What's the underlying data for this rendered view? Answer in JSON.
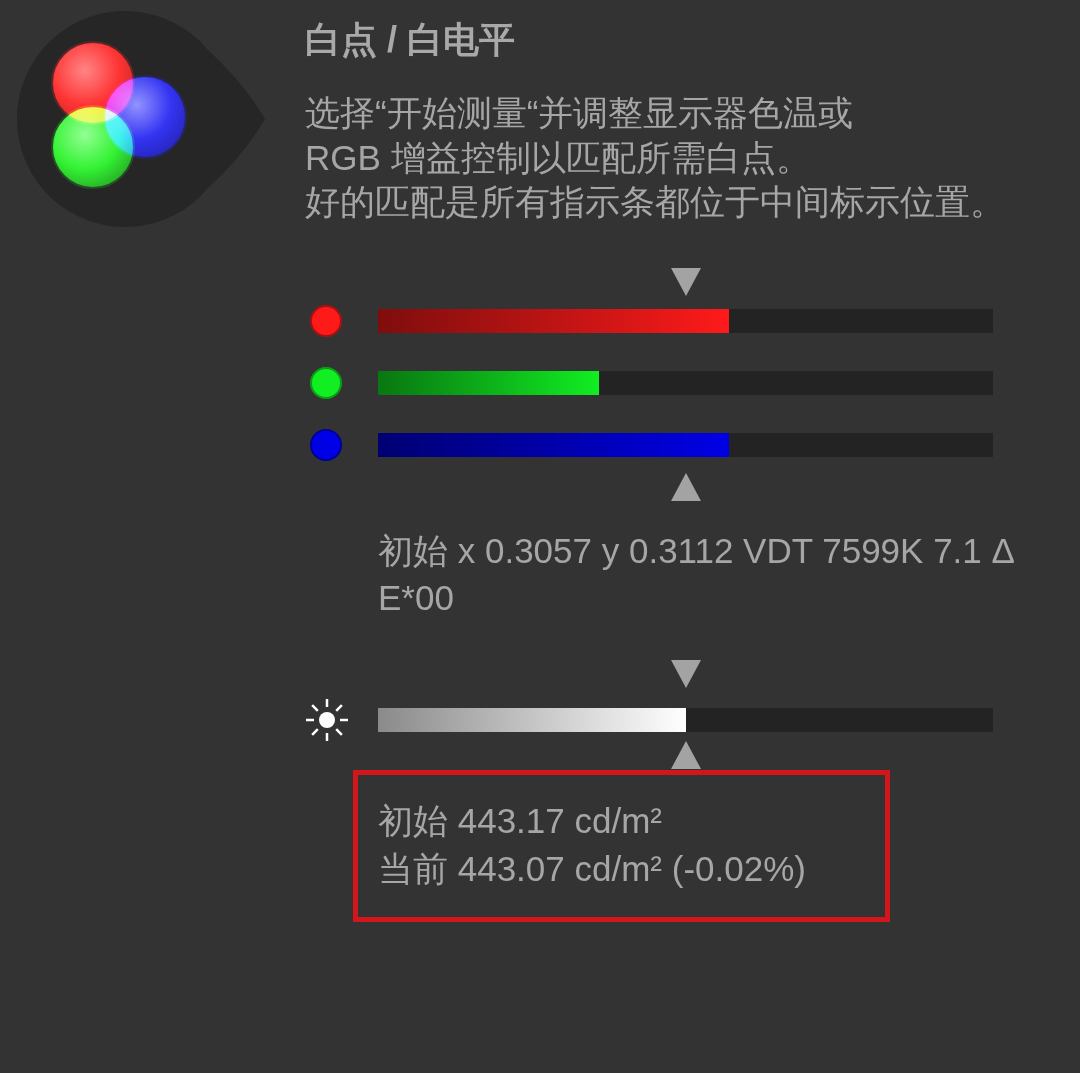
{
  "title": "白点 / 白电平",
  "instructions": [
    "选择“开始测量“并调整显示器色温或",
    "RGB 增益控制以匹配所需白点。",
    "好的匹配是所有指示条都位于中间标示位置。"
  ],
  "channels": [
    {
      "color": "#ff1a1a",
      "level": 0.57
    },
    {
      "color": "#11ee22",
      "level": 0.36
    },
    {
      "color": "#0000e6",
      "level": 0.57
    }
  ],
  "chromaticity_reading": [
    "初始 x 0.3057 y 0.3112 VDT 7599K 7.1 Δ",
    "E*00"
  ],
  "luminance": {
    "level": 0.5,
    "highlighted": true,
    "readings": [
      "初始 443.17 cd/m²",
      "当前 443.07 cd/m² (-0.02%)"
    ]
  }
}
